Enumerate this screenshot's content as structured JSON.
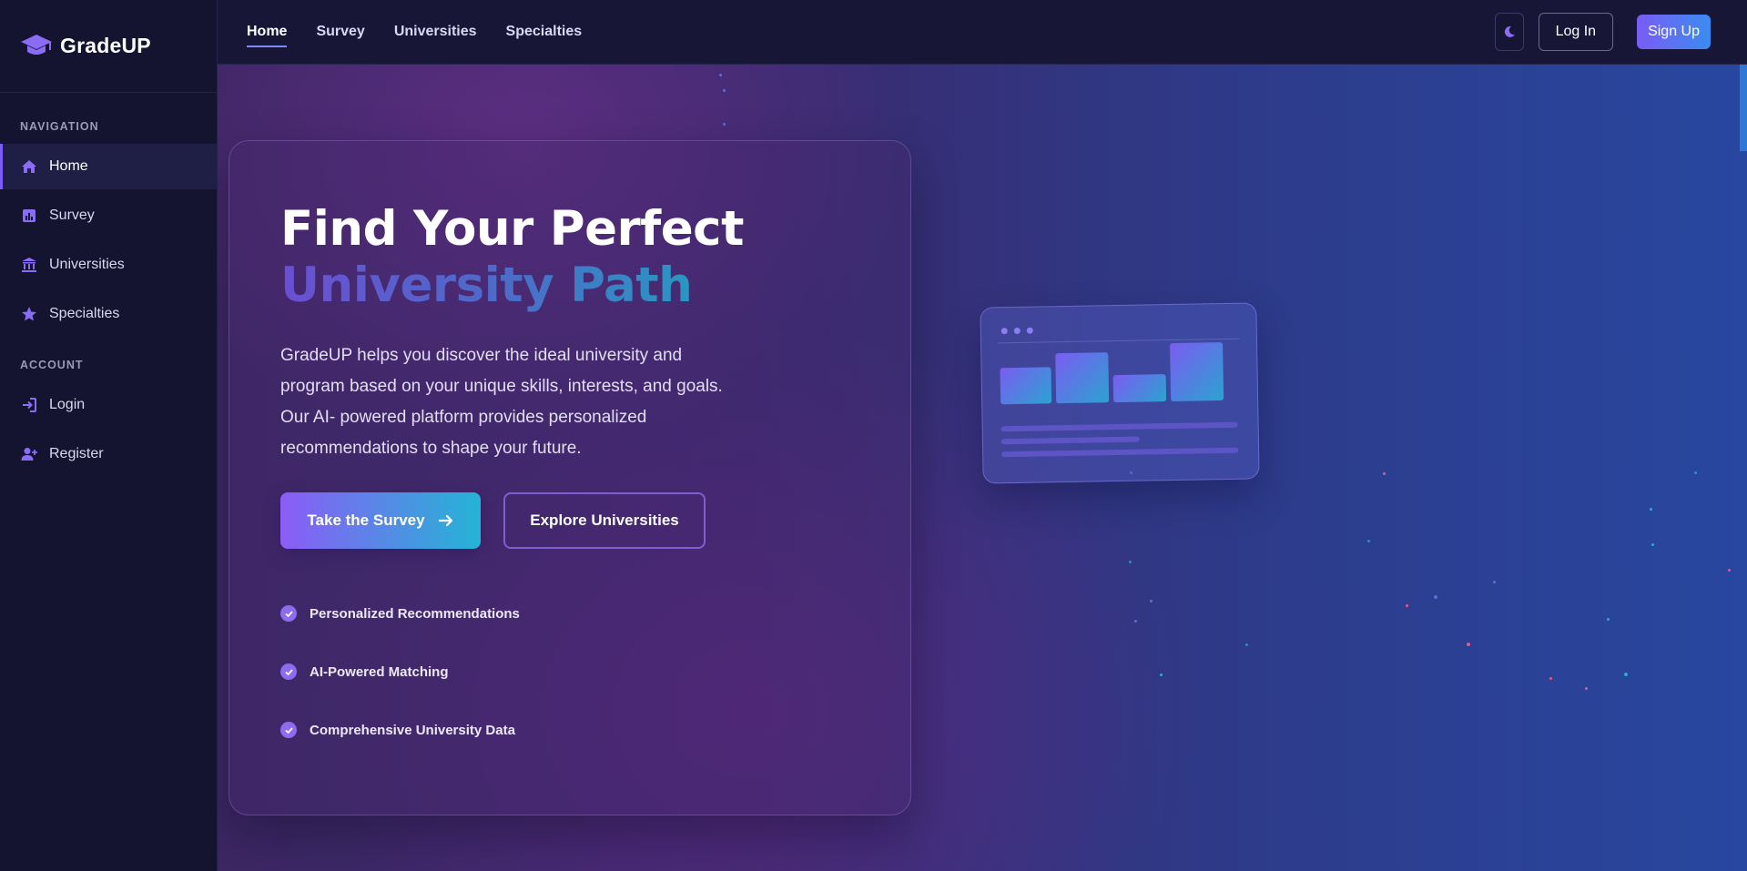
{
  "brand": {
    "name": "GradeUP",
    "icon": "graduation-cap-icon"
  },
  "sidebar": {
    "nav_label": "NAVIGATION",
    "nav_items": [
      {
        "label": "Home",
        "icon": "home-icon",
        "active": true
      },
      {
        "label": "Survey",
        "icon": "chart-icon",
        "active": false
      },
      {
        "label": "Universities",
        "icon": "university-icon",
        "active": false
      },
      {
        "label": "Specialties",
        "icon": "star-icon",
        "active": false
      }
    ],
    "account_label": "ACCOUNT",
    "account_items": [
      {
        "label": "Login",
        "icon": "login-icon"
      },
      {
        "label": "Register",
        "icon": "user-plus-icon"
      }
    ]
  },
  "topnav": {
    "items": [
      "Home",
      "Survey",
      "Universities",
      "Specialties"
    ],
    "active": "Home",
    "theme_icon": "moon-icon",
    "login_label": "Log In",
    "signup_label": "Sign Up"
  },
  "hero": {
    "title_line1": "Find Your Perfect",
    "title_line2": "University Path",
    "description": "GradeUP helps you discover the ideal university and program based on your unique skills, interests, and goals. Our AI- powered platform provides personalized recommendations to shape your future.",
    "primary_button": "Take the Survey",
    "secondary_button": "Explore Universities",
    "features": [
      "Personalized Recommendations",
      "AI-Powered Matching",
      "Comprehensive University Data"
    ]
  },
  "colors": {
    "accent": "#7c5cf6",
    "sidebar_bg": "#141431",
    "topbar_bg": "#171636",
    "gradient_cyan": "#24b4d6"
  }
}
